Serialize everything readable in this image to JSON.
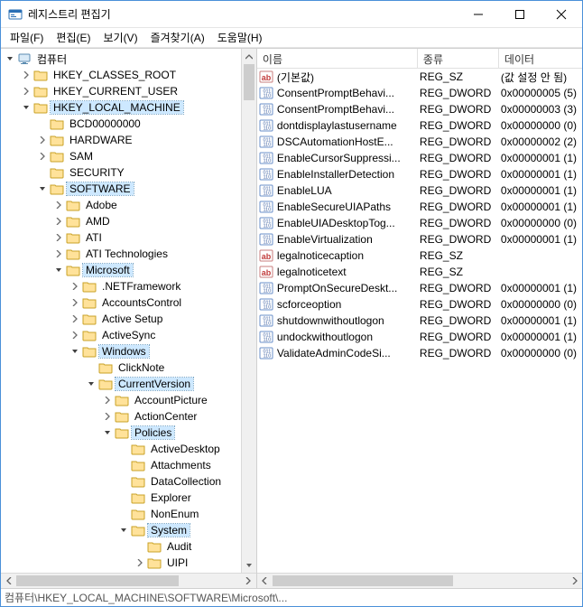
{
  "window": {
    "title": "레지스트리 편집기"
  },
  "menu": {
    "file": "파일(F)",
    "edit": "편집(E)",
    "view": "보기(V)",
    "favorites": "즐겨찾기(A)",
    "help": "도움말(H)"
  },
  "columns": {
    "name": "이름",
    "type": "종류",
    "data": "데이터"
  },
  "tree": {
    "root": "컴퓨터",
    "hkcr": "HKEY_CLASSES_ROOT",
    "hkcu": "HKEY_CURRENT_USER",
    "hklm": "HKEY_LOCAL_MACHINE",
    "bcd": "BCD00000000",
    "hardware": "HARDWARE",
    "sam": "SAM",
    "security": "SECURITY",
    "software": "SOFTWARE",
    "adobe": "Adobe",
    "amd": "AMD",
    "ati": "ATI",
    "atitech": "ATI Technologies",
    "microsoft": "Microsoft",
    "netfx": ".NETFramework",
    "accountscontrol": "AccountsControl",
    "activesetup": "Active Setup",
    "activesync": "ActiveSync",
    "windows": "Windows",
    "clicknote": "ClickNote",
    "currentversion": "CurrentVersion",
    "accountpicture": "AccountPicture",
    "actioncenter": "ActionCenter",
    "policies": "Policies",
    "activedesktop": "ActiveDesktop",
    "attachments": "Attachments",
    "datacollection": "DataCollection",
    "explorer": "Explorer",
    "nonenum": "NonEnum",
    "system": "System",
    "audit": "Audit",
    "uipi": "UIPI"
  },
  "values": [
    {
      "icon": "sz",
      "name": "(기본값)",
      "type": "REG_SZ",
      "data": "(값 설정 안 됨)"
    },
    {
      "icon": "dw",
      "name": "ConsentPromptBehavi...",
      "type": "REG_DWORD",
      "data": "0x00000005 (5)"
    },
    {
      "icon": "dw",
      "name": "ConsentPromptBehavi...",
      "type": "REG_DWORD",
      "data": "0x00000003 (3)"
    },
    {
      "icon": "dw",
      "name": "dontdisplaylastusername",
      "type": "REG_DWORD",
      "data": "0x00000000 (0)"
    },
    {
      "icon": "dw",
      "name": "DSCAutomationHostE...",
      "type": "REG_DWORD",
      "data": "0x00000002 (2)"
    },
    {
      "icon": "dw",
      "name": "EnableCursorSuppressi...",
      "type": "REG_DWORD",
      "data": "0x00000001 (1)"
    },
    {
      "icon": "dw",
      "name": "EnableInstallerDetection",
      "type": "REG_DWORD",
      "data": "0x00000001 (1)"
    },
    {
      "icon": "dw",
      "name": "EnableLUA",
      "type": "REG_DWORD",
      "data": "0x00000001 (1)"
    },
    {
      "icon": "dw",
      "name": "EnableSecureUIAPaths",
      "type": "REG_DWORD",
      "data": "0x00000001 (1)"
    },
    {
      "icon": "dw",
      "name": "EnableUIADesktopTog...",
      "type": "REG_DWORD",
      "data": "0x00000000 (0)"
    },
    {
      "icon": "dw",
      "name": "EnableVirtualization",
      "type": "REG_DWORD",
      "data": "0x00000001 (1)"
    },
    {
      "icon": "sz",
      "name": "legalnoticecaption",
      "type": "REG_SZ",
      "data": ""
    },
    {
      "icon": "sz",
      "name": "legalnoticetext",
      "type": "REG_SZ",
      "data": ""
    },
    {
      "icon": "dw",
      "name": "PromptOnSecureDeskt...",
      "type": "REG_DWORD",
      "data": "0x00000001 (1)"
    },
    {
      "icon": "dw",
      "name": "scforceoption",
      "type": "REG_DWORD",
      "data": "0x00000000 (0)"
    },
    {
      "icon": "dw",
      "name": "shutdownwithoutlogon",
      "type": "REG_DWORD",
      "data": "0x00000001 (1)"
    },
    {
      "icon": "dw",
      "name": "undockwithoutlogon",
      "type": "REG_DWORD",
      "data": "0x00000001 (1)"
    },
    {
      "icon": "dw",
      "name": "ValidateAdminCodeSi...",
      "type": "REG_DWORD",
      "data": "0x00000000 (0)"
    }
  ],
  "status": "컴퓨터\\HKEY_LOCAL_MACHINE\\SOFTWARE\\Microsoft\\..."
}
